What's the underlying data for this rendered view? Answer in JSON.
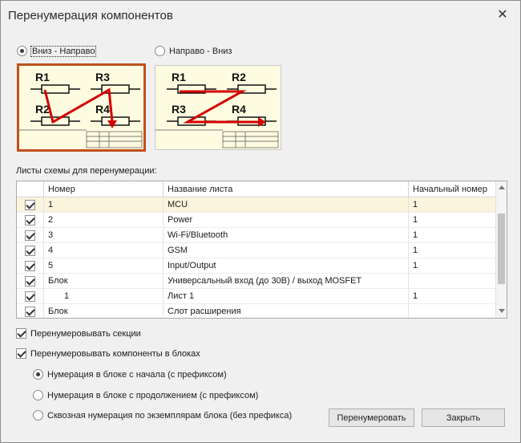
{
  "window": {
    "title": "Перенумерация компонентов",
    "close_glyph": "✕"
  },
  "direction": {
    "options": [
      {
        "label": "Вниз - Направо",
        "selected": true
      },
      {
        "label": "Направо - Вниз",
        "selected": false
      }
    ],
    "preview_left": {
      "r1": "R1",
      "r2": "R2",
      "r3": "R3",
      "r4": "R4"
    },
    "preview_right": {
      "r1": "R1",
      "r2": "R2",
      "r3": "R3",
      "r4": "R4"
    },
    "accent_color": "#c0501c",
    "arrow_color": "#d40000"
  },
  "sheets": {
    "label": "Листы схемы для перенумерации:",
    "columns": [
      "Номер",
      "Название листа",
      "Начальный номер"
    ],
    "rows": [
      {
        "checked": true,
        "number": "1",
        "name": "MCU",
        "start": "1",
        "highlight": true
      },
      {
        "checked": true,
        "number": "2",
        "name": "Power",
        "start": "1"
      },
      {
        "checked": true,
        "number": "3",
        "name": "Wi-Fi/Bluetooth",
        "start": "1"
      },
      {
        "checked": true,
        "number": "4",
        "name": "GSM",
        "start": "1"
      },
      {
        "checked": true,
        "number": "5",
        "name": "Input/Output",
        "start": "1"
      },
      {
        "checked": true,
        "number": "Блок",
        "name": "Универсальный вход (до 30В) / выход MOSFET",
        "start": ""
      },
      {
        "checked": true,
        "number": "1",
        "name": "Лист 1",
        "start": "1",
        "indent": true
      },
      {
        "checked": true,
        "number": "Блок",
        "name": "Слот расширения",
        "start": ""
      }
    ]
  },
  "options": {
    "renumber_sections": "Перенумеровывать секции",
    "renumber_in_blocks": "Перенумеровывать компоненты в блоках",
    "block_modes": [
      {
        "label": "Нумерация в блоке с начала (с префиксом)",
        "selected": true
      },
      {
        "label": "Нумерация в блоке с продолжением (с префиксом)",
        "selected": false
      },
      {
        "label": "Сквозная нумерация по экземплярам блока (без префикса)",
        "selected": false
      }
    ]
  },
  "buttons": {
    "renumber": "Перенумеровать",
    "close": "Закрыть"
  }
}
